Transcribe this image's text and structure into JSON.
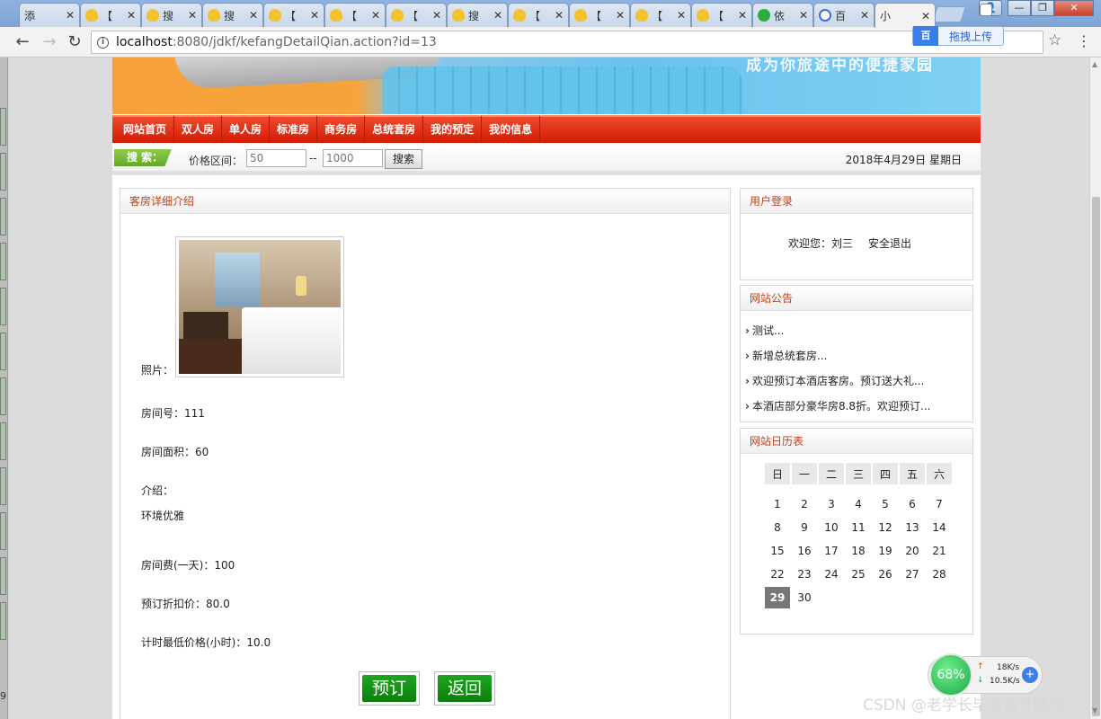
{
  "browser": {
    "tabs": [
      {
        "title": "添",
        "icon": "page"
      },
      {
        "title": "【",
        "icon": "cup"
      },
      {
        "title": "搜",
        "icon": "cup"
      },
      {
        "title": "搜",
        "icon": "cup"
      },
      {
        "title": "【",
        "icon": "cup"
      },
      {
        "title": "【",
        "icon": "cup"
      },
      {
        "title": "【",
        "icon": "cup"
      },
      {
        "title": "搜",
        "icon": "cup"
      },
      {
        "title": "【",
        "icon": "cup"
      },
      {
        "title": "【",
        "icon": "cup"
      },
      {
        "title": "【",
        "icon": "cup"
      },
      {
        "title": "【",
        "icon": "cup"
      },
      {
        "title": "依",
        "icon": "wechat"
      },
      {
        "title": "百",
        "icon": "baidu"
      },
      {
        "title": "小",
        "icon": "page"
      }
    ],
    "tab_close": "✕",
    "url_host": "localhost",
    "url_path": ":8080/jdkf/kefangDetailQian.action?id=13",
    "extension_label": "拖拽上传",
    "extension_logo": "百"
  },
  "site": {
    "slogan": "成为你旅途中的便捷家园",
    "nav": [
      "网站首页",
      "双人房",
      "单人房",
      "标准房",
      "商务房",
      "总统套房",
      "我的预定",
      "我的信息"
    ],
    "search": {
      "tag": "搜 索：",
      "price_label": "价格区间：",
      "min_placeholder": "50",
      "dash": "--",
      "max_placeholder": "1000",
      "button": "搜索"
    },
    "date": "2018年4月29日 星期日"
  },
  "detail": {
    "title": "客房详细介绍",
    "photo_label": "照片：",
    "room_no": "房间号：111",
    "area": "房间面积：60",
    "intro_label": "介绍：",
    "intro": "环境优雅",
    "fee": "房间费(一天)：100",
    "discount": "预订折扣价：80.0",
    "hourly_min": "计时最低价格(小时)：10.0",
    "book_button": "预订",
    "back_button": "返回"
  },
  "login": {
    "title": "用户登录",
    "welcome": "欢迎您：刘三",
    "logout": "安全退出"
  },
  "notice": {
    "title": "网站公告",
    "items": [
      "测试...",
      "新增总统套房...",
      "欢迎预订本酒店客房。预订送大礼...",
      "本酒店部分豪华房8.8折。欢迎预订..."
    ]
  },
  "calendar": {
    "title": "网站日历表",
    "weekdays": [
      "日",
      "一",
      "二",
      "三",
      "四",
      "五",
      "六"
    ],
    "weeks": [
      [
        "1",
        "2",
        "3",
        "4",
        "5",
        "6",
        "7"
      ],
      [
        "8",
        "9",
        "10",
        "11",
        "12",
        "13",
        "14"
      ],
      [
        "15",
        "16",
        "17",
        "18",
        "19",
        "20",
        "21"
      ],
      [
        "22",
        "23",
        "24",
        "25",
        "26",
        "27",
        "28"
      ],
      [
        "29",
        "30",
        "",
        "",
        "",
        "",
        ""
      ]
    ],
    "today": "29"
  },
  "widget": {
    "percent": "68%",
    "up": "18K/s",
    "down": "10.5K/s"
  },
  "watermark": "CSDN @老学长毕业设计辅导",
  "colors": {
    "nav_red": "#d21c06",
    "panel_title": "#c0401e",
    "search_green": "#62a82a",
    "button_green": "#0c7f0c"
  }
}
